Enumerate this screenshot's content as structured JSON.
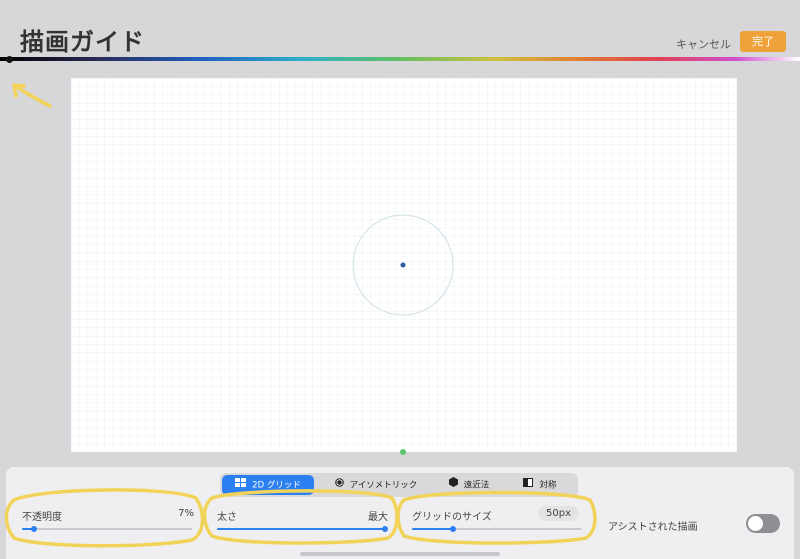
{
  "header": {
    "title": "描画ガイド",
    "cancel_label": "キャンセル",
    "done_label": "完了"
  },
  "tabs": [
    {
      "label": "2D グリッド",
      "icon": "grid-icon",
      "active": true
    },
    {
      "label": "アイソメトリック",
      "icon": "cube-icon",
      "active": false
    },
    {
      "label": "遠近法",
      "icon": "perspective-icon",
      "active": false
    },
    {
      "label": "対称",
      "icon": "symmetry-icon",
      "active": false
    }
  ],
  "controls": {
    "opacity": {
      "label": "不透明度",
      "value": "7%",
      "level": 0.07
    },
    "thickness": {
      "label": "太さ",
      "value": "最大",
      "level": 1.0
    },
    "grid_size": {
      "label": "グリッドのサイズ",
      "value": "50px",
      "level": 0.24
    }
  },
  "assisted_drawing": {
    "label": "アシストされた描画",
    "enabled": false
  },
  "colors": {
    "accent": "#2c7ff0",
    "done_button": "#f0a23a",
    "annotation": "#f2d35a",
    "grid_line": "#e4eaf0"
  }
}
